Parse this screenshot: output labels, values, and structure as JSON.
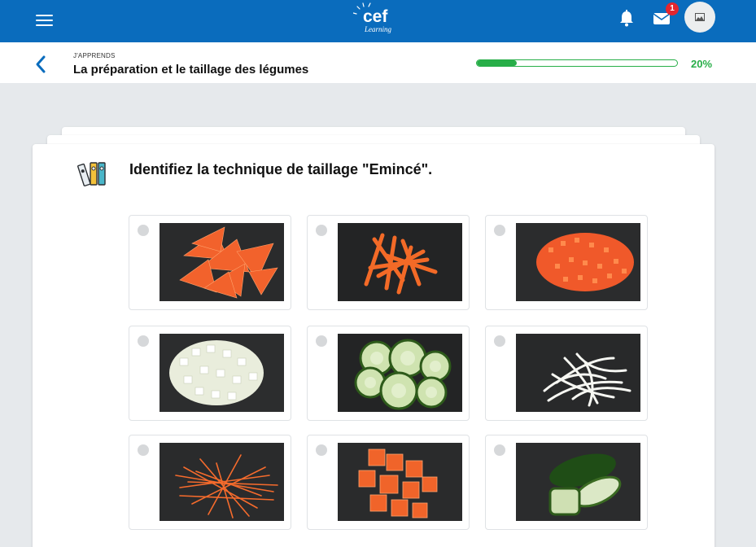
{
  "app": {
    "logo_text": "cef",
    "logo_sub": "Learning",
    "brand_color": "#0a6cbd"
  },
  "topbar": {
    "menu_icon": "hamburger-menu-icon",
    "notifications_icon": "bell-icon",
    "messages_icon": "envelope-icon",
    "messages_badge": "1",
    "avatar_icon": "image-placeholder-icon"
  },
  "header": {
    "breadcrumb": "J'APPRENDS",
    "title": "La préparation et le taillage des légumes",
    "back_icon": "chevron-left-icon",
    "progress_value": 0.2,
    "progress_label": "20%",
    "progress_color": "#27ae48"
  },
  "question": {
    "icon": "binders-icon",
    "text": "Identifiez la technique de taillage \"Emincé\"."
  },
  "options": [
    {
      "depicts": "carrot-triangles-photo",
      "selected": false
    },
    {
      "depicts": "carrot-sticks-photo",
      "selected": false
    },
    {
      "depicts": "carrot-small-dice-photo",
      "selected": false
    },
    {
      "depicts": "onion-dice-photo",
      "selected": false
    },
    {
      "depicts": "cucumber-rounds-photo",
      "selected": false
    },
    {
      "depicts": "onion-strips-photo",
      "selected": false
    },
    {
      "depicts": "carrot-julienne-photo",
      "selected": false
    },
    {
      "depicts": "carrot-cubes-photo",
      "selected": false
    },
    {
      "depicts": "zucchini-halves-photo",
      "selected": false
    }
  ]
}
